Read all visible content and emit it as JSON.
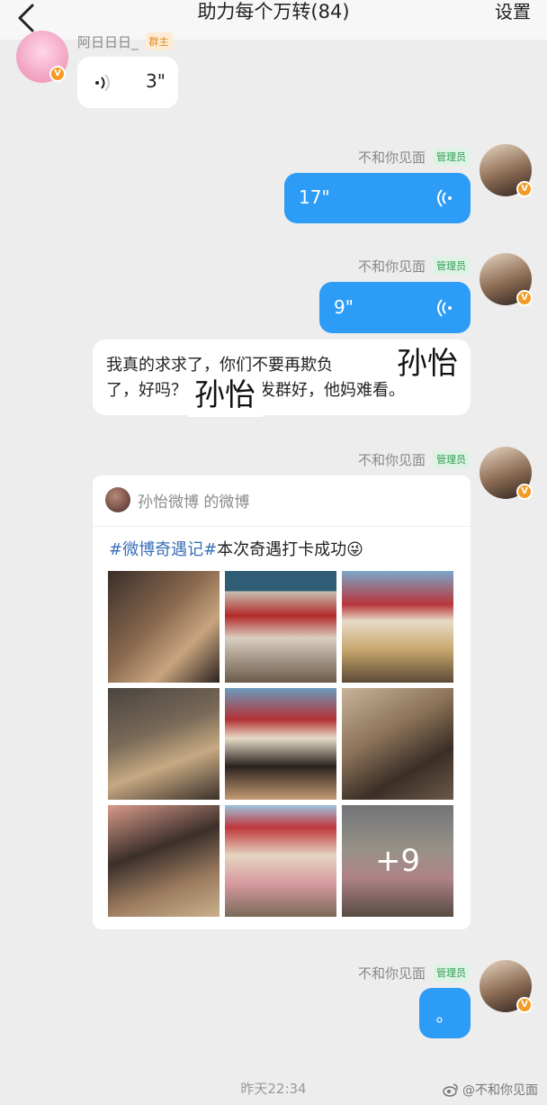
{
  "header": {
    "title": "助力每个万转(84)",
    "settings_label": "设置"
  },
  "messages": [
    {
      "sender": "阿日日日_",
      "role": "群主",
      "voice_duration": "3\""
    },
    {
      "sender": "不和你见面",
      "role": "管理员",
      "voice_duration": "17\""
    },
    {
      "sender": "不和你见面",
      "role": "管理员",
      "voice_duration": "9\""
    },
    {
      "text_line1": "我真的求求了，你们不要再欺负",
      "text_line2": "了，好吗？",
      "text_line2b": "转发群好，他妈难看。",
      "sticker1": "孙怡",
      "sticker2": "孙怡"
    },
    {
      "sender": "不和你见面",
      "role": "管理员",
      "card": {
        "from": "孙怡微博 的微博",
        "tag1": "#微博奇遇记#",
        "text": "本次奇遇打卡成功",
        "emoji": "😜",
        "more": "+9"
      }
    },
    {
      "sender": "不和你见面",
      "role": "管理员",
      "text": "。"
    }
  ],
  "timestamp": "昨天22:34",
  "watermark": "@不和你见面",
  "colors": {
    "bubble_blue": "#2c9cf6",
    "background": "#ededed",
    "admin_badge": "#2e9e55",
    "owner_badge": "#e08a1d"
  },
  "icons": [
    "back-chevron-icon",
    "voice-wave-icon",
    "verified-badge-icon",
    "weibo-logo-icon"
  ]
}
